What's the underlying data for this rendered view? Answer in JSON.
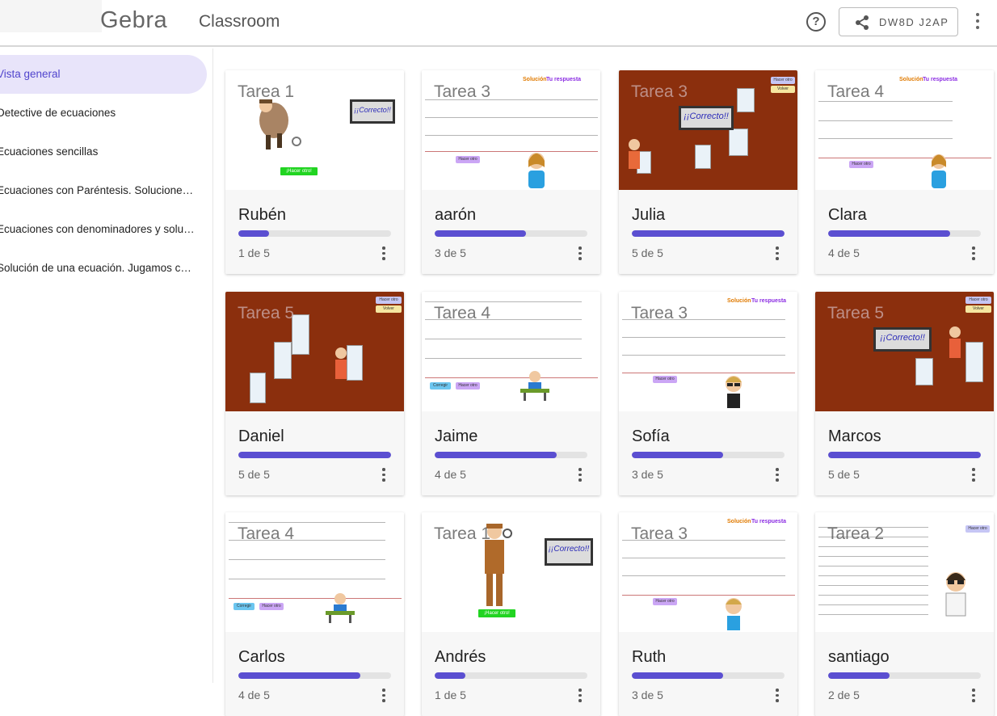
{
  "header": {
    "logo_text": "Gebra",
    "brand_sub": "Classroom",
    "help_icon": "help-circle-icon",
    "share_icon": "share-icon",
    "share_code": "DW8D J2AP",
    "more_icon": "more-vertical-icon"
  },
  "sidebar": {
    "items": [
      {
        "label": "Vista general",
        "active": true
      },
      {
        "label": "Detective de ecuaciones",
        "active": false
      },
      {
        "label": "Ecuaciones sencillas",
        "active": false
      },
      {
        "label": "Ecuaciones con Paréntesis. Soluciones ...",
        "active": false
      },
      {
        "label": "Ecuaciones con denominadores y soluc...",
        "active": false
      },
      {
        "label": "Solución de una ecuación. Jugamos co...",
        "active": false
      }
    ]
  },
  "colors": {
    "accent": "#5b4fd1",
    "active_bg": "#e8e4fa",
    "thumb_brown": "#8b2f0d"
  },
  "students": [
    {
      "name": "Rubén",
      "task": "Tarea 1",
      "progress": "1 de 5",
      "done": 1,
      "total": 5,
      "theme": "detective-correct"
    },
    {
      "name": "aarón",
      "task": "Tarea 3",
      "progress": "3 de 5",
      "done": 3,
      "total": 5,
      "theme": "table"
    },
    {
      "name": "Julia",
      "task": "Tarea 3",
      "progress": "5 de 5",
      "done": 5,
      "total": 5,
      "theme": "brown-correct"
    },
    {
      "name": "Clara",
      "task": "Tarea 4",
      "progress": "4 de 5",
      "done": 4,
      "total": 5,
      "theme": "table"
    },
    {
      "name": "Daniel",
      "task": "Tarea 5",
      "progress": "5 de 5",
      "done": 5,
      "total": 5,
      "theme": "brown"
    },
    {
      "name": "Jaime",
      "task": "Tarea 4",
      "progress": "4 de 5",
      "done": 4,
      "total": 5,
      "theme": "table"
    },
    {
      "name": "Sofía",
      "task": "Tarea 3",
      "progress": "3 de 5",
      "done": 3,
      "total": 5,
      "theme": "table"
    },
    {
      "name": "Marcos",
      "task": "Tarea 5",
      "progress": "5 de 5",
      "done": 5,
      "total": 5,
      "theme": "brown-correct"
    },
    {
      "name": "Carlos",
      "task": "Tarea 4",
      "progress": "4 de 5",
      "done": 4,
      "total": 5,
      "theme": "table"
    },
    {
      "name": "Andrés",
      "task": "Tarea 1",
      "progress": "1 de 5",
      "done": 1,
      "total": 5,
      "theme": "detective-correct"
    },
    {
      "name": "Ruth",
      "task": "Tarea 3",
      "progress": "3 de 5",
      "done": 3,
      "total": 5,
      "theme": "table"
    },
    {
      "name": "santiago",
      "task": "Tarea 2",
      "progress": "2 de 5",
      "done": 2,
      "total": 5,
      "theme": "table"
    }
  ],
  "thumb_text": {
    "solucion": "Solución",
    "tu_respuesta": "Tu respuesta",
    "hacer_otro": "Hacer otro",
    "volver": "Volver",
    "corregir": "Corregir",
    "correcto": "¡¡Correcto!!",
    "hacer_otro_excl": "¡Hacer otro!"
  }
}
